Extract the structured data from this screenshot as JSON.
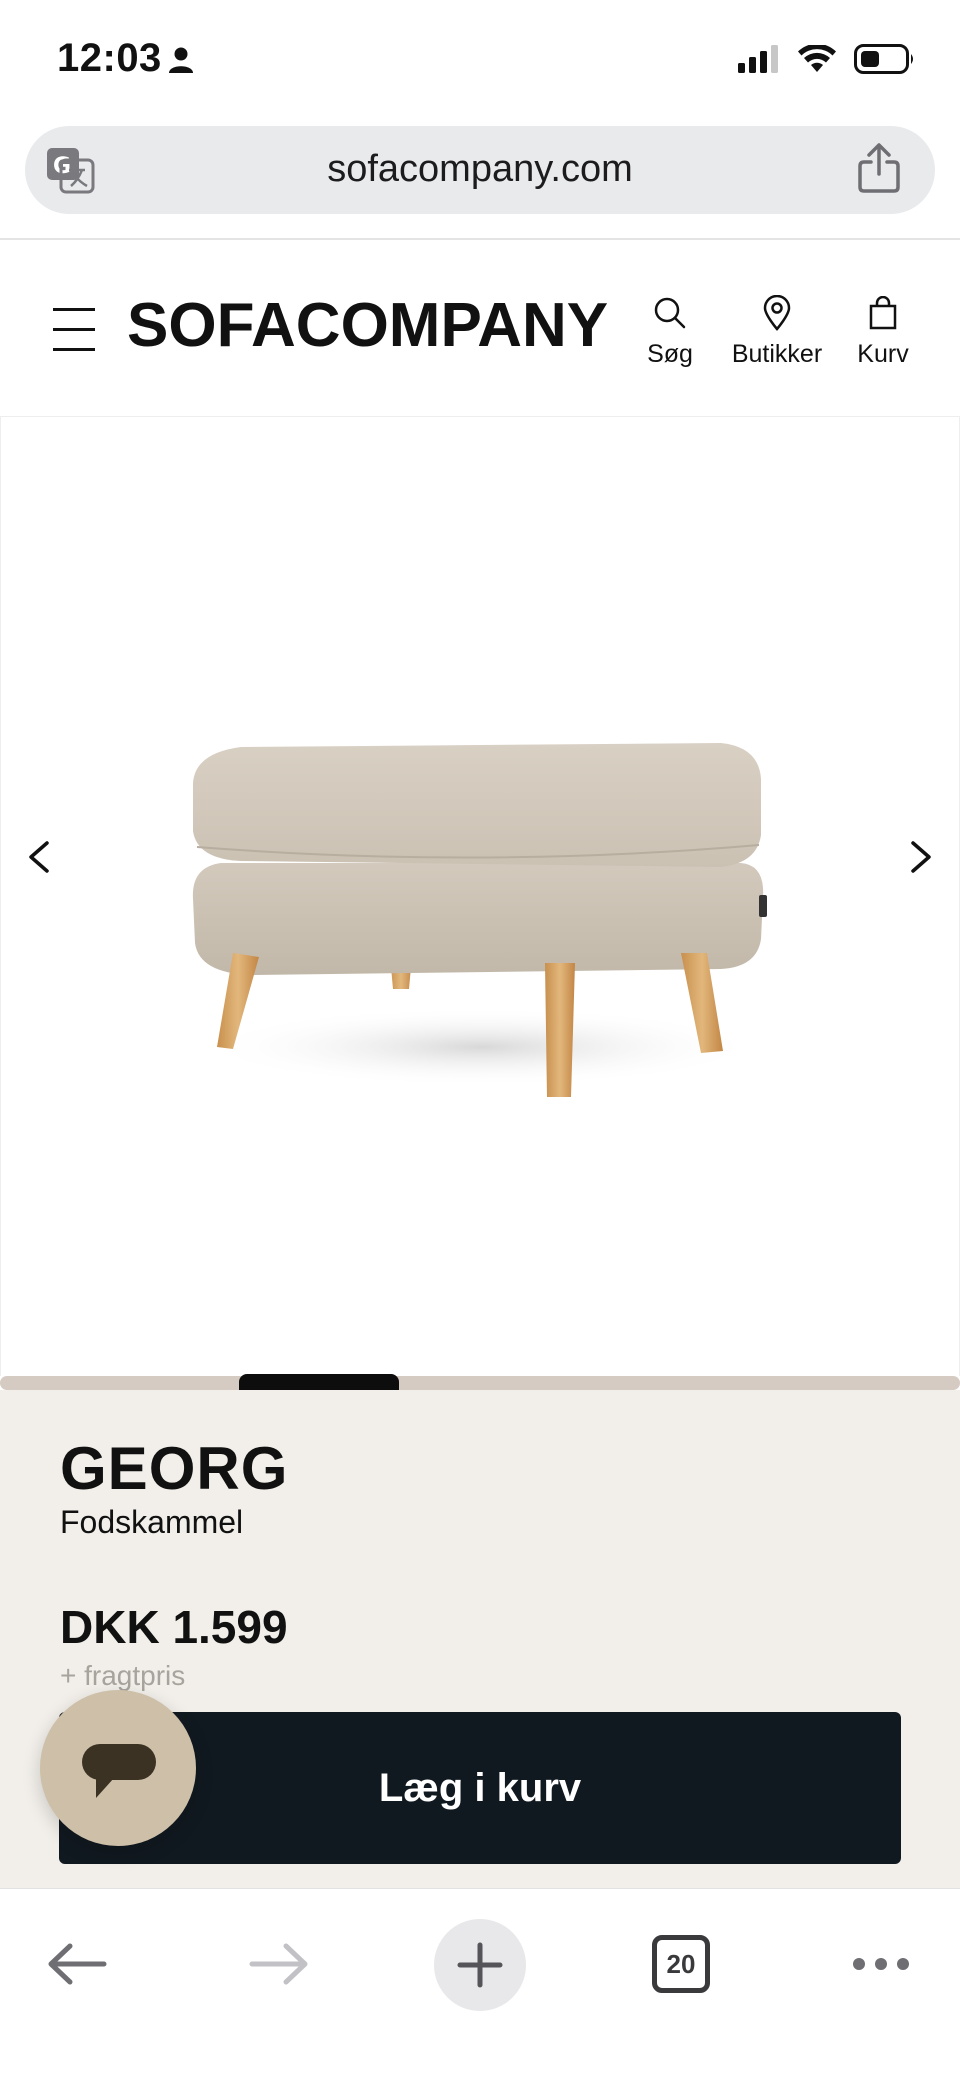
{
  "status_bar": {
    "time": "12:03"
  },
  "browser": {
    "url": "sofacompany.com",
    "tab_count": "20"
  },
  "header": {
    "logo": "SOFACOMPANY",
    "nav": {
      "search_label": "Søg",
      "stores_label": "Butikker",
      "cart_label": "Kurv"
    }
  },
  "gallery": {
    "progress_fraction": 0.167
  },
  "product": {
    "name": "GEORG",
    "type": "Fodskammel",
    "price": "DKK 1.599",
    "shipping_note": "+ fragtpris",
    "add_to_cart_label": "Læg i kurv"
  },
  "colors": {
    "info_background": "#f2efea",
    "button_background": "#111920",
    "chat_bubble": "#cdbfa8",
    "progress_track": "#d6cbc2"
  },
  "icons": {
    "status": [
      "person-icon",
      "signal-icon",
      "wifi-icon",
      "battery-icon"
    ],
    "browser": [
      "translate-icon",
      "share-icon",
      "back-arrow-icon",
      "forward-arrow-icon",
      "plus-icon",
      "tabs-icon",
      "more-icon"
    ],
    "header": [
      "hamburger-icon",
      "search-icon",
      "location-pin-icon",
      "shopping-bag-icon"
    ]
  }
}
